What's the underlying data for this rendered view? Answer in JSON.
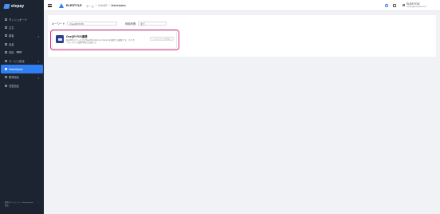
{
  "app": {
    "logo_text": "elepay"
  },
  "sidebar": {
    "items": [
      {
        "label": "ダッシュボード",
        "icon": "dashboard-icon"
      },
      {
        "label": "注文",
        "icon": "orders-icon"
      },
      {
        "label": "顧客",
        "icon": "customers-icon",
        "caret": "▾"
      },
      {
        "label": "返金",
        "icon": "refund-icon"
      },
      {
        "label": "資料",
        "icon": "documents-icon",
        "badge": "NEW"
      },
      {
        "label": "サービス設定",
        "icon": "service-settings-icon",
        "caret": "▾"
      },
      {
        "label": "Marketplace",
        "icon": "marketplace-icon",
        "active": true
      },
      {
        "label": "開発設定",
        "icon": "dev-settings-icon",
        "caret": "▾"
      },
      {
        "label": "児童設定",
        "icon": "settings-icon"
      }
    ],
    "footer": {
      "line1": "最新のバージョン",
      "line2": "更新"
    }
  },
  "header": {
    "account_name": "ELESTYLE",
    "breadcrumb": [
      "ホーム",
      "OneQR",
      "Marketplace"
    ],
    "user_name": "ELESTYLE",
    "user_sub": "elestyle@example.com"
  },
  "filters": {
    "keyword_label": "キーワード",
    "keyword_value": "OneQR POS",
    "status_label": "利用状態",
    "status_value": "全て"
  },
  "items": [
    {
      "title": "OneQR POS連携",
      "description": "ELEPAYのサービスとDinerBox Express Systemを連携する機能です。スマホでオーダーの連携可能な店舗です。",
      "button": "インストール済み"
    }
  ],
  "colors": {
    "sidebar_bg": "#1b2430",
    "accent": "#2f7ef2",
    "highlight": "#d6307a"
  }
}
